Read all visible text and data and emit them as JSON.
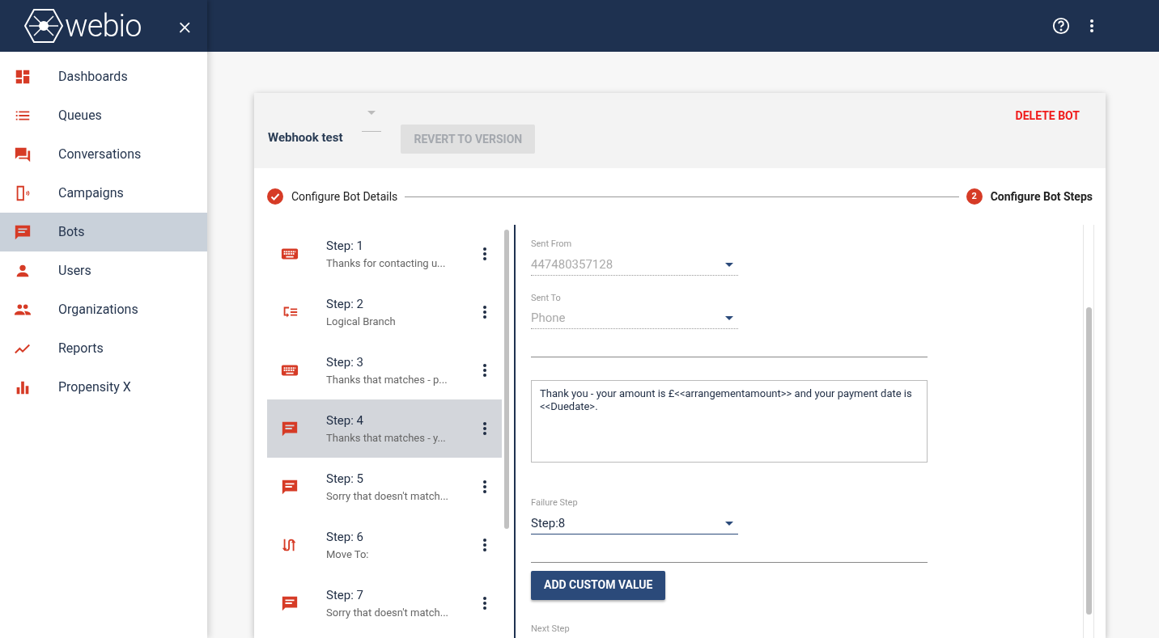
{
  "header": {
    "logo": "webio",
    "close": "×"
  },
  "sidebar": {
    "items": [
      {
        "label": "Dashboards",
        "selected": false
      },
      {
        "label": "Queues",
        "selected": false
      },
      {
        "label": "Conversations",
        "selected": false
      },
      {
        "label": "Campaigns",
        "selected": false
      },
      {
        "label": "Bots",
        "selected": true
      },
      {
        "label": "Users",
        "selected": false
      },
      {
        "label": "Organizations",
        "selected": false
      },
      {
        "label": "Reports",
        "selected": false
      },
      {
        "label": "Propensity X",
        "selected": false
      }
    ]
  },
  "bot": {
    "name": "Webhook test",
    "revert_button": {
      "label": "REVERT TO VERSION",
      "disabled": true
    },
    "delete_button": "DELETE BOT"
  },
  "stepper": [
    {
      "label": "Configure Bot Details",
      "done": true
    },
    {
      "label": "Configure Bot Steps",
      "number": "2",
      "done": false
    }
  ],
  "steps": [
    {
      "title": "Step: 1",
      "subtitle": "Thanks for contacting u...",
      "kind": "keyboard",
      "selected": false
    },
    {
      "title": "Step: 2",
      "subtitle": "Logical Branch",
      "kind": "branch",
      "selected": false
    },
    {
      "title": "Step: 3",
      "subtitle": "Thanks that matches - p...",
      "kind": "keyboard",
      "selected": false
    },
    {
      "title": "Step: 4",
      "subtitle": "Thanks that matches - y...",
      "kind": "message",
      "selected": true
    },
    {
      "title": "Step: 5",
      "subtitle": "Sorry that doesn't match...",
      "kind": "message",
      "selected": false
    },
    {
      "title": "Step: 6",
      "subtitle": "Move To:",
      "kind": "move",
      "selected": false
    },
    {
      "title": "Step: 7",
      "subtitle": "Sorry that doesn't match...",
      "kind": "message",
      "selected": false
    }
  ],
  "form": [
    {
      "kind": "select",
      "label": "Sent From",
      "value": "447480357128",
      "disabled": true
    },
    {
      "kind": "select",
      "label": "Sent To",
      "value": "Phone",
      "disabled": true
    },
    {
      "kind": "line"
    },
    {
      "kind": "textarea",
      "value": "Thank you - your amount is £<<arrangementamount>> and your payment date is <<Duedate>."
    },
    {
      "kind": "select",
      "label": "Failure Step",
      "value": "Step:8",
      "disabled": false
    },
    {
      "kind": "line"
    },
    {
      "kind": "button",
      "label": "ADD CUSTOM VALUE"
    },
    {
      "kind": "label",
      "label": "Next Step"
    }
  ]
}
